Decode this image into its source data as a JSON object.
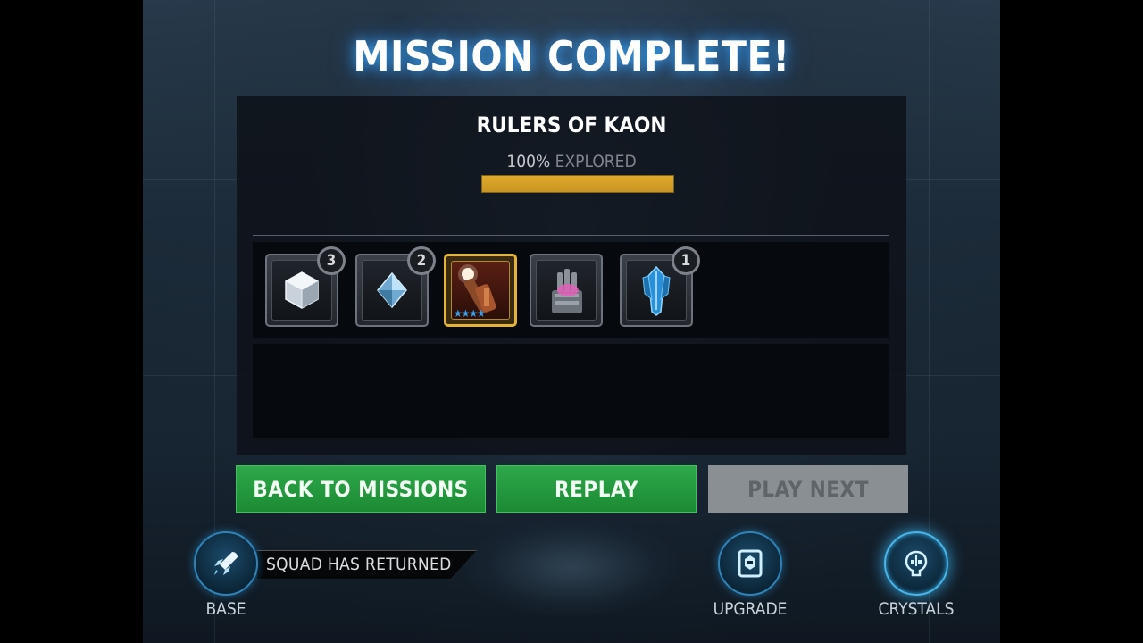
{
  "title": "MISSION COMPLETE!",
  "mission": {
    "name": "RULERS OF KAON",
    "explored_percent_text": "100%",
    "explored_label": "EXPLORED",
    "explored_progress": 1.0
  },
  "rewards": [
    {
      "name": "crystal-cube-icon",
      "count": "3"
    },
    {
      "name": "crystal-shard-icon",
      "count": "2"
    },
    {
      "name": "hero-portrait-icon",
      "count": null,
      "stars": "★★★★"
    },
    {
      "name": "gauntlet-gear-icon",
      "count": null
    },
    {
      "name": "blue-crystal-icon",
      "count": "1"
    }
  ],
  "buttons": {
    "back": "BACK TO MISSIONS",
    "replay": "REPLAY",
    "play_next": "PLAY NEXT"
  },
  "nav": {
    "base": "BASE",
    "squad_status": "SQUAD HAS RETURNED",
    "upgrade": "UPGRADE",
    "crystals": "CRYSTALS"
  },
  "colors": {
    "progress": "#d9a428",
    "button_green": "#24973f",
    "button_disabled": "#8a8f94",
    "glow_blue": "#3cbeff"
  }
}
